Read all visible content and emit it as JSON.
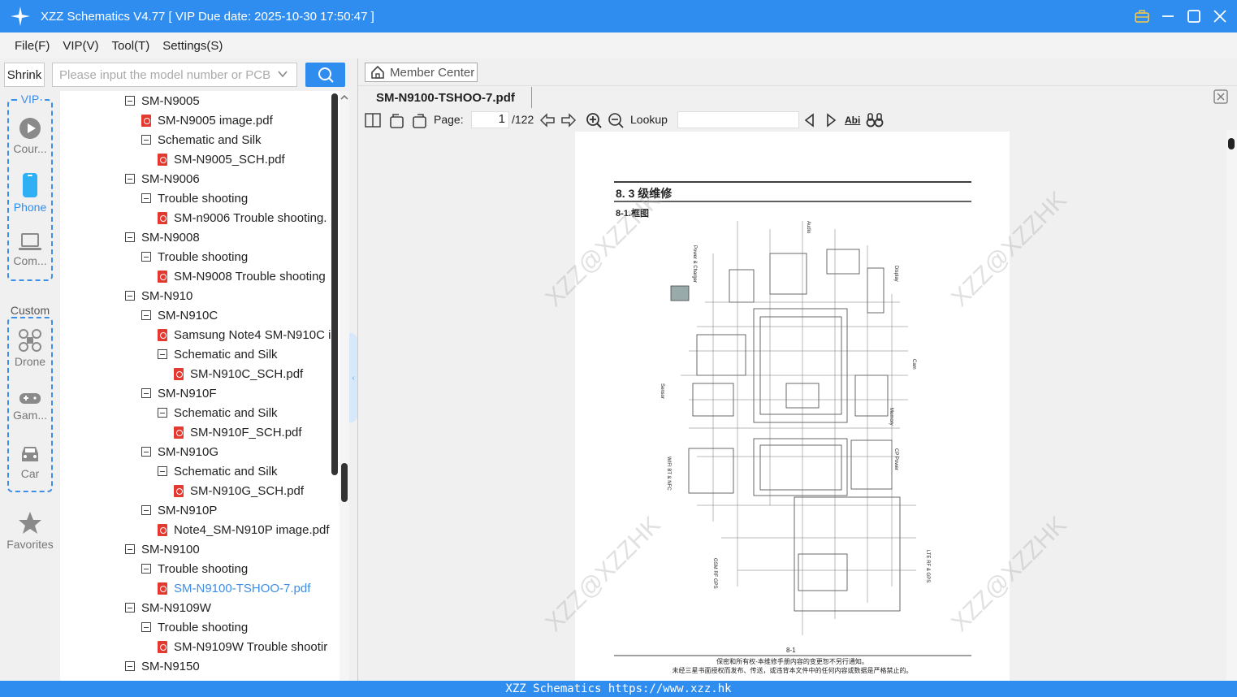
{
  "app": {
    "title": "XZZ Schematics V4.77 [ VIP Due date: 2025-10-30 17:50:47 ]"
  },
  "menu": [
    "File(F)",
    "VIP(V)",
    "Tool(T)",
    "Settings(S)"
  ],
  "search": {
    "shrink_label": "Shrink",
    "placeholder": "Please input the model number or PCB"
  },
  "sidebar": {
    "vip_label": "VIP",
    "custom_label": "Custom",
    "items": [
      {
        "label": "Cour...",
        "icon": "play-circle-icon"
      },
      {
        "label": "Phone",
        "icon": "phone-icon"
      },
      {
        "label": "Com...",
        "icon": "laptop-icon"
      },
      {
        "label": "Drone",
        "icon": "drone-icon"
      },
      {
        "label": "Gam...",
        "icon": "gamepad-icon"
      },
      {
        "label": "Car",
        "icon": "car-icon"
      },
      {
        "label": "Favorites",
        "icon": "star-icon"
      }
    ]
  },
  "tree": [
    {
      "level": 0,
      "type": "folder",
      "label": "SM-N9005"
    },
    {
      "level": 1,
      "type": "pdf",
      "label": "SM-N9005 image.pdf"
    },
    {
      "level": 1,
      "type": "folder",
      "label": "Schematic and Silk"
    },
    {
      "level": 2,
      "type": "pdf",
      "label": "SM-N9005_SCH.pdf"
    },
    {
      "level": 0,
      "type": "folder",
      "label": "SM-N9006"
    },
    {
      "level": 1,
      "type": "folder",
      "label": "Trouble shooting"
    },
    {
      "level": 2,
      "type": "pdf",
      "label": "SM-n9006 Trouble shooting."
    },
    {
      "level": 0,
      "type": "folder",
      "label": "SM-N9008"
    },
    {
      "level": 1,
      "type": "folder",
      "label": "Trouble shooting"
    },
    {
      "level": 2,
      "type": "pdf",
      "label": "SM-N9008 Trouble shooting"
    },
    {
      "level": 0,
      "type": "folder",
      "label": "SM-N910"
    },
    {
      "level": 1,
      "type": "folder",
      "label": "SM-N910C"
    },
    {
      "level": 2,
      "type": "pdf",
      "label": "Samsung Note4 SM-N910C i"
    },
    {
      "level": 2,
      "type": "folder",
      "label": "Schematic and Silk"
    },
    {
      "level": 3,
      "type": "pdf",
      "label": "SM-N910C_SCH.pdf"
    },
    {
      "level": 1,
      "type": "folder",
      "label": "SM-N910F"
    },
    {
      "level": 2,
      "type": "folder",
      "label": "Schematic and Silk"
    },
    {
      "level": 3,
      "type": "pdf",
      "label": "SM-N910F_SCH.pdf"
    },
    {
      "level": 1,
      "type": "folder",
      "label": "SM-N910G"
    },
    {
      "level": 2,
      "type": "folder",
      "label": "Schematic and Silk"
    },
    {
      "level": 3,
      "type": "pdf",
      "label": "SM-N910G_SCH.pdf"
    },
    {
      "level": 1,
      "type": "folder",
      "label": "SM-N910P"
    },
    {
      "level": 2,
      "type": "pdf",
      "label": "Note4_SM-N910P image.pdf"
    },
    {
      "level": 0,
      "type": "folder",
      "label": "SM-N9100"
    },
    {
      "level": 1,
      "type": "folder",
      "label": "Trouble shooting"
    },
    {
      "level": 2,
      "type": "pdf",
      "label": "SM-N9100-TSHOO-7.pdf",
      "selected": true
    },
    {
      "level": 0,
      "type": "folder",
      "label": "SM-N9109W"
    },
    {
      "level": 1,
      "type": "folder",
      "label": "Trouble shooting"
    },
    {
      "level": 2,
      "type": "pdf",
      "label": "SM-N9109W Trouble shootir"
    },
    {
      "level": 0,
      "type": "folder",
      "label": "SM-N9150"
    }
  ],
  "viewer": {
    "member_center": "Member Center",
    "tab_title": "SM-N9100-TSHOO-7.pdf",
    "page_label": "Page:",
    "page_current": "1",
    "page_total": "/122",
    "lookup_label": "Lookup",
    "abi_label": "Abi"
  },
  "pdf": {
    "heading": "8. 3 级维修",
    "subheading": "8-1.框图",
    "page_number": "8-1",
    "footer_line1": "保密和所有权-本维修手册内容的变更恕不另行通知。",
    "footer_line2": "未经三星书面授权而发布、传送，或违背本文件中的任何内容或数据是严格禁止的。",
    "watermark": "XZZ@XZZHK",
    "labels": [
      "Power & Charger",
      "Audio",
      "Display",
      "Cam",
      "Sensor",
      "Memory",
      "CP Power",
      "WIFI BT & NFC",
      "LTE RF & GPS",
      "GSM RF GPS"
    ]
  },
  "status": {
    "text": "XZZ Schematics https://www.xzz.hk"
  },
  "colors": {
    "accent": "#2f8df0",
    "selected_text": "#3d8ee8",
    "pdf_icon": "#e23a30"
  }
}
